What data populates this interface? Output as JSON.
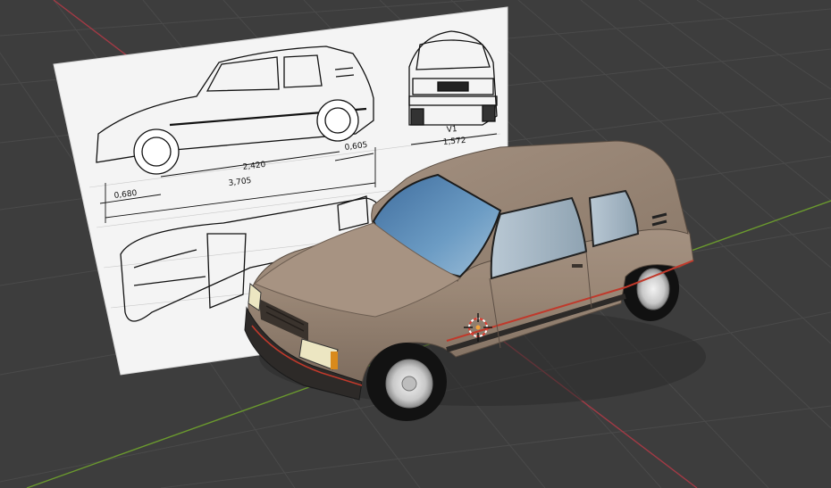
{
  "viewport": {
    "background": "#3d3d3d",
    "grid_color": "#4a4a4a",
    "x_axis_color": "#a33a45",
    "y_axis_color": "#6b9a2e"
  },
  "blueprint": {
    "dimensions": {
      "front_overhang": "0,680",
      "wheelbase": "2,420",
      "rear_overhang": "0,605",
      "overall_length": "3,705",
      "front_view_label": "V1",
      "track_width": "1,572"
    }
  },
  "car": {
    "body_color": "#9a8776",
    "glass_color": "#5f8fb8",
    "stripe_color": "#c0392b"
  },
  "origin_icon": "3d-cursor-icon"
}
